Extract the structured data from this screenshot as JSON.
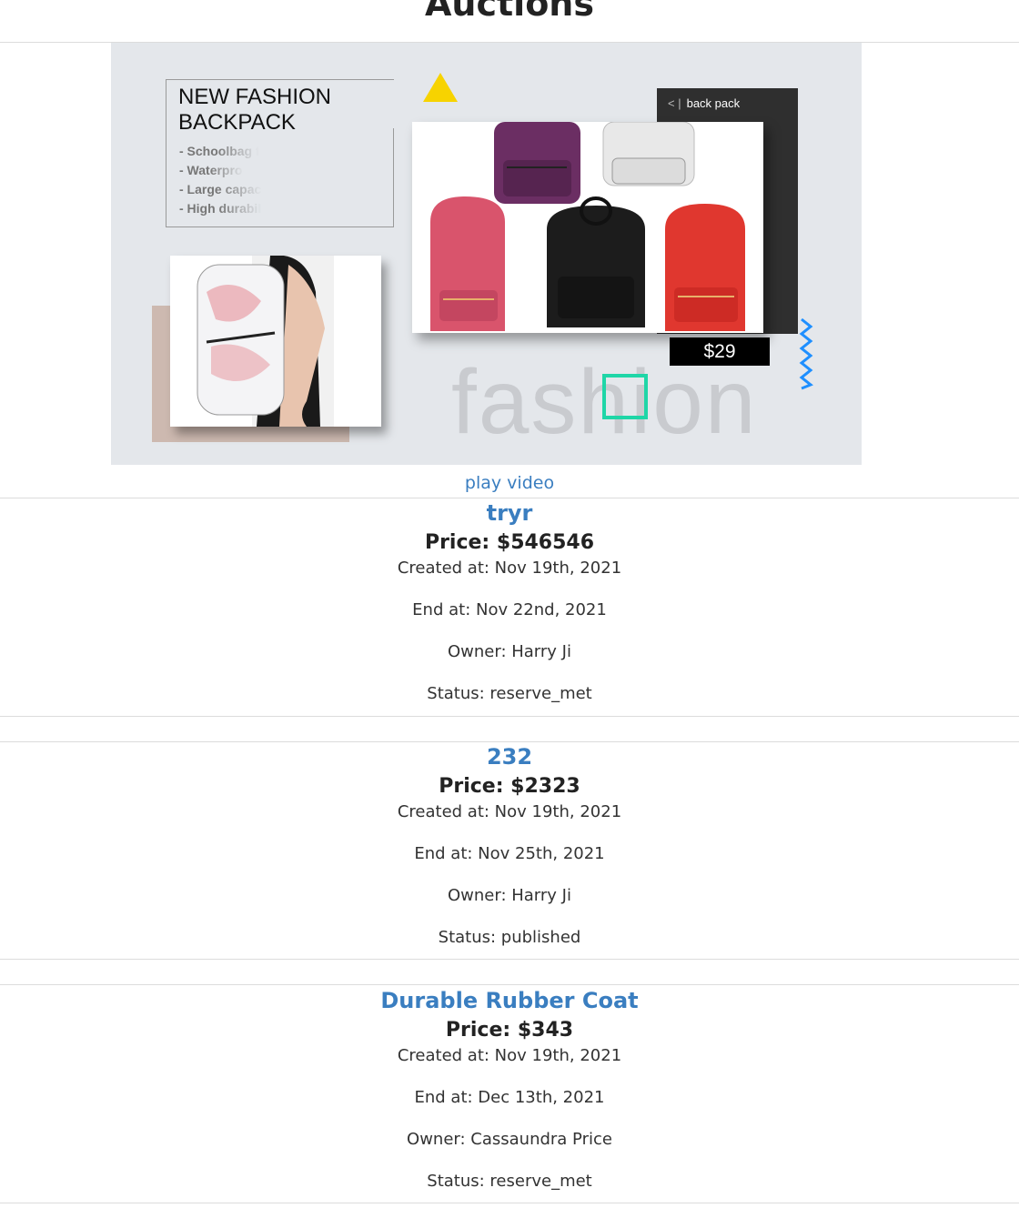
{
  "page": {
    "title": "Auctions"
  },
  "banner": {
    "heading": "NEW FASHION BACKPACK",
    "features": [
      "- Schoolbag for",
      "- Waterproof",
      "- Large capacity",
      "- High durability"
    ],
    "nav_label": "back pack",
    "price": "$29",
    "watermark": "fashion",
    "colors": {
      "background": "#e4e7eb",
      "triangle": "#f7d300",
      "square": "#1fd6a7",
      "zigzag": "#1e8fff"
    }
  },
  "video": {
    "link_label": "play video"
  },
  "labels": {
    "price_prefix": "Price: ",
    "created_prefix": "Created at: ",
    "end_prefix": "End at: ",
    "owner_prefix": "Owner: ",
    "status_prefix": "Status: "
  },
  "auctions": [
    {
      "title": "tryr",
      "price": "Price: $546546",
      "created": "Created at: Nov 19th, 2021",
      "end": "End at: Nov 22nd, 2021",
      "owner": "Owner: Harry Ji",
      "status": "Status: reserve_met"
    },
    {
      "title": "232",
      "price": "Price: $2323",
      "created": "Created at: Nov 19th, 2021",
      "end": "End at: Nov 25th, 2021",
      "owner": "Owner: Harry Ji",
      "status": "Status: published"
    },
    {
      "title": "Durable Rubber Coat",
      "price": "Price: $343",
      "created": "Created at: Nov 19th, 2021",
      "end": "End at: Dec 13th, 2021",
      "owner": "Owner: Cassaundra Price",
      "status": "Status: reserve_met"
    }
  ]
}
